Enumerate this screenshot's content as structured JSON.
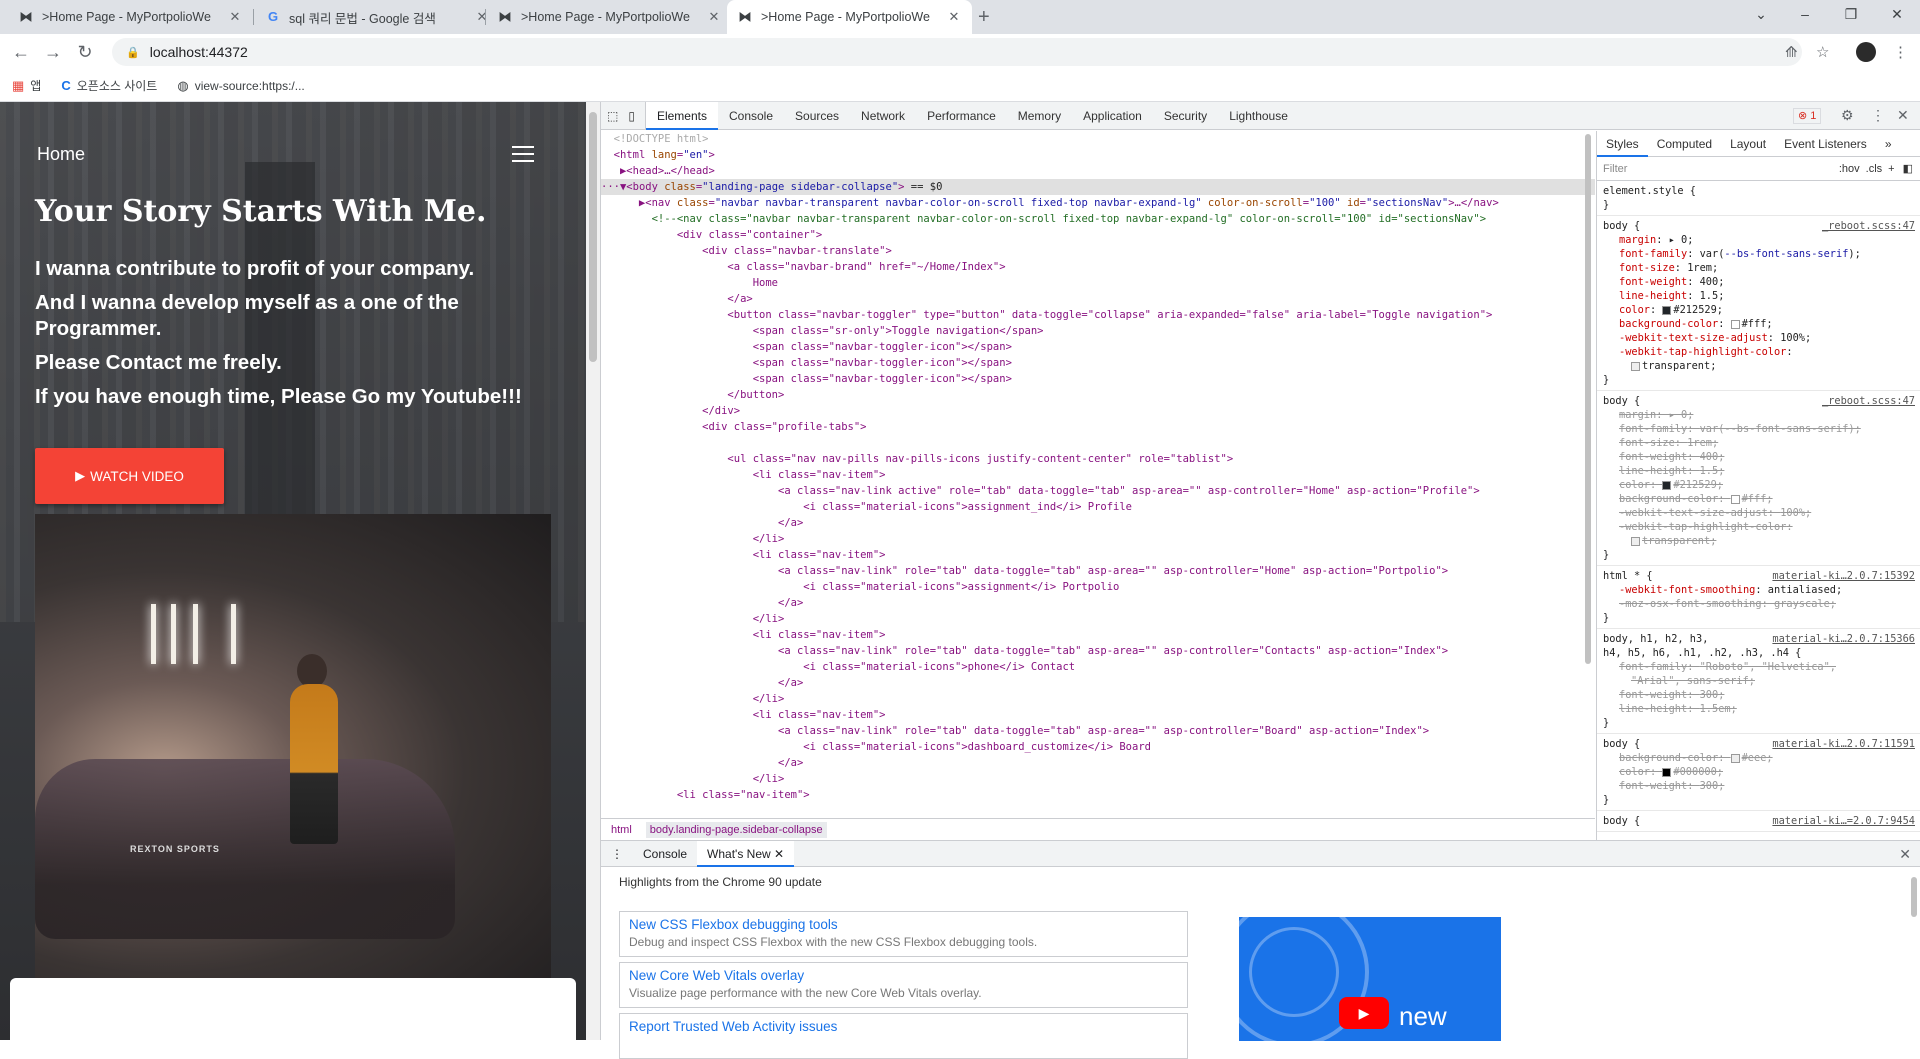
{
  "browser": {
    "tabs": [
      {
        "title": ">Home Page - MyPortpolioWe",
        "favicon": "mask-icon",
        "active": false
      },
      {
        "title": "sql 쿼리 문법 - Google 검색",
        "favicon": "google-icon",
        "active": false
      },
      {
        "title": ">Home Page - MyPortpolioWe",
        "favicon": "mask-icon",
        "active": false
      },
      {
        "title": ">Home Page - MyPortpolioWe",
        "favicon": "mask-icon",
        "active": true
      }
    ],
    "url": "localhost:44372",
    "bookmarks": [
      {
        "label": "앱",
        "icon": "apps-grid-icon"
      },
      {
        "label": "오픈소스 사이트",
        "icon": "c-logo-icon"
      },
      {
        "label": "view-source:https:/...",
        "icon": "globe-icon"
      }
    ]
  },
  "site": {
    "brand": "Home",
    "title": "Your Story Starts With Me.",
    "lines": [
      "I wanna contribute to profit of your company.",
      "And I wanna develop myself as a one of the Programmer.",
      "Please Contact me freely.",
      "If you have enough time, Please Go my Youtube!!!"
    ],
    "watch_button": "WATCH VIDEO",
    "photo_plate": "REXTON SPORTS"
  },
  "devtools": {
    "tabs": [
      "Elements",
      "Console",
      "Sources",
      "Network",
      "Performance",
      "Memory",
      "Application",
      "Security",
      "Lighthouse"
    ],
    "active_tab": "Elements",
    "error_count": "1",
    "breadcrumbs": [
      "html",
      "body.landing-page.sidebar-collapse"
    ],
    "styles_tabs": [
      "Styles",
      "Computed",
      "Layout",
      "Event Listeners"
    ],
    "filter_placeholder": "Filter",
    "filter_hov": ":hov",
    "filter_cls": ".cls",
    "element_style": "element.style {",
    "drawer_tabs": [
      "Console",
      "What's New"
    ],
    "highlights": "Highlights from the Chrome 90 update",
    "whats_new": [
      {
        "title": "New CSS Flexbox debugging tools",
        "desc": "Debug and inspect CSS Flexbox with the new CSS Flexbox debugging tools."
      },
      {
        "title": "New Core Web Vitals overlay",
        "desc": "Visualize page performance with the new Core Web Vitals overlay."
      },
      {
        "title": "Report Trusted Web Activity issues",
        "desc": ""
      }
    ],
    "whats_new_image_text": "new"
  }
}
